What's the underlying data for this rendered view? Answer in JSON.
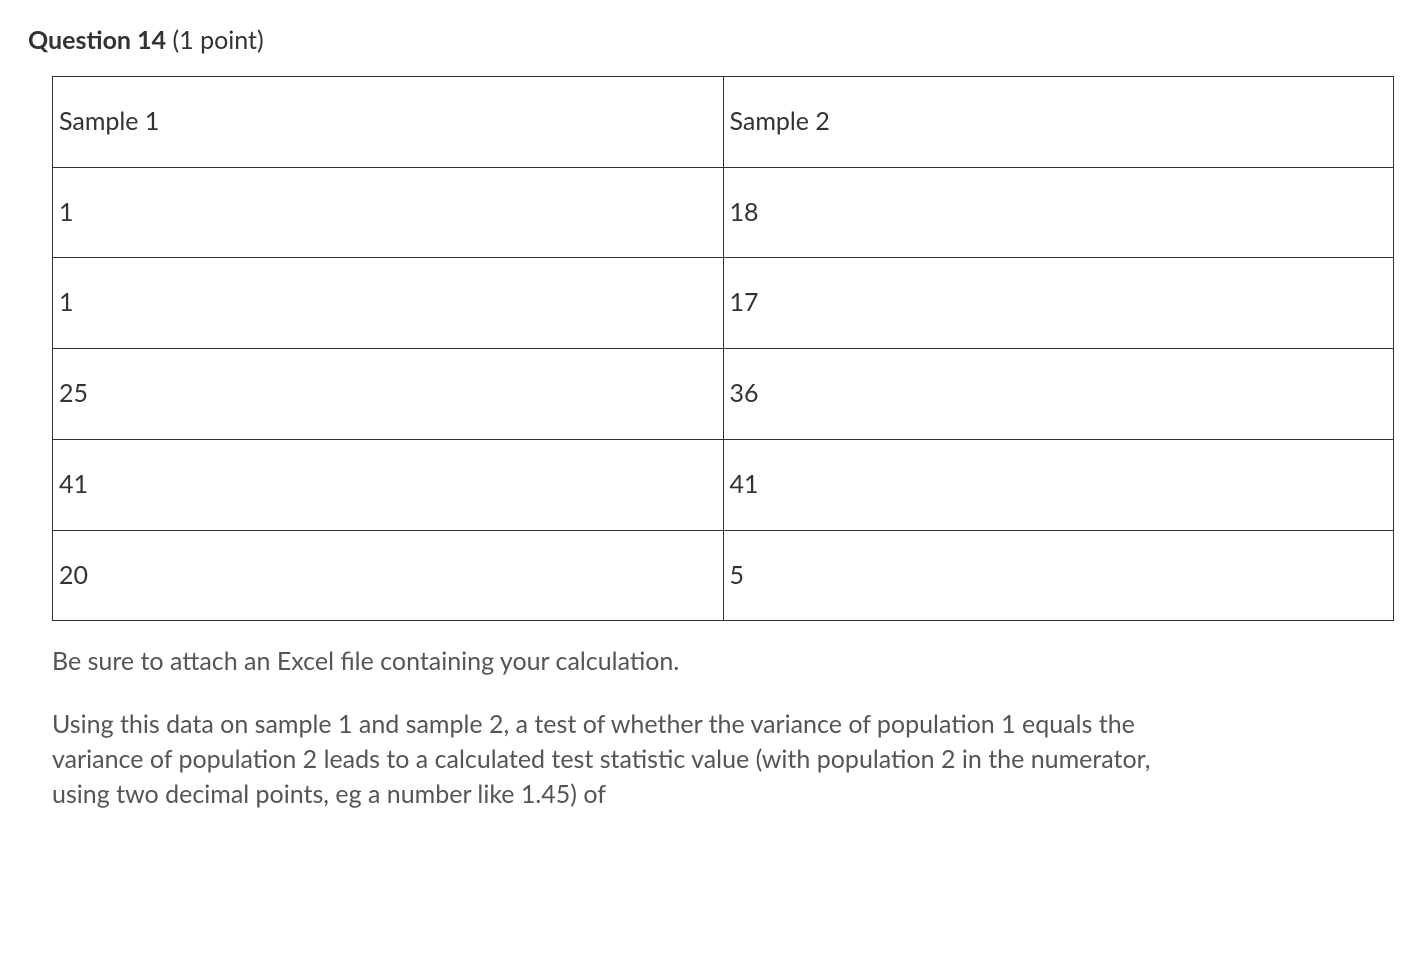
{
  "header": {
    "question_label": "Question 14",
    "points_label": " (1 point)"
  },
  "table": {
    "headers": [
      "Sample 1",
      "Sample 2"
    ],
    "rows": [
      [
        "1",
        "18"
      ],
      [
        "1",
        "17"
      ],
      [
        "25",
        "36"
      ],
      [
        "41",
        "41"
      ],
      [
        "20",
        "5"
      ]
    ]
  },
  "instruction": "Be sure to attach an Excel file containing your calculation.",
  "prompt": "Using this data on sample 1 and sample 2, a test of whether the variance of population 1 equals the variance of population 2 leads to a calculated test statistic value (with population 2 in the numerator, using two decimal points, eg a number like 1.45) of"
}
